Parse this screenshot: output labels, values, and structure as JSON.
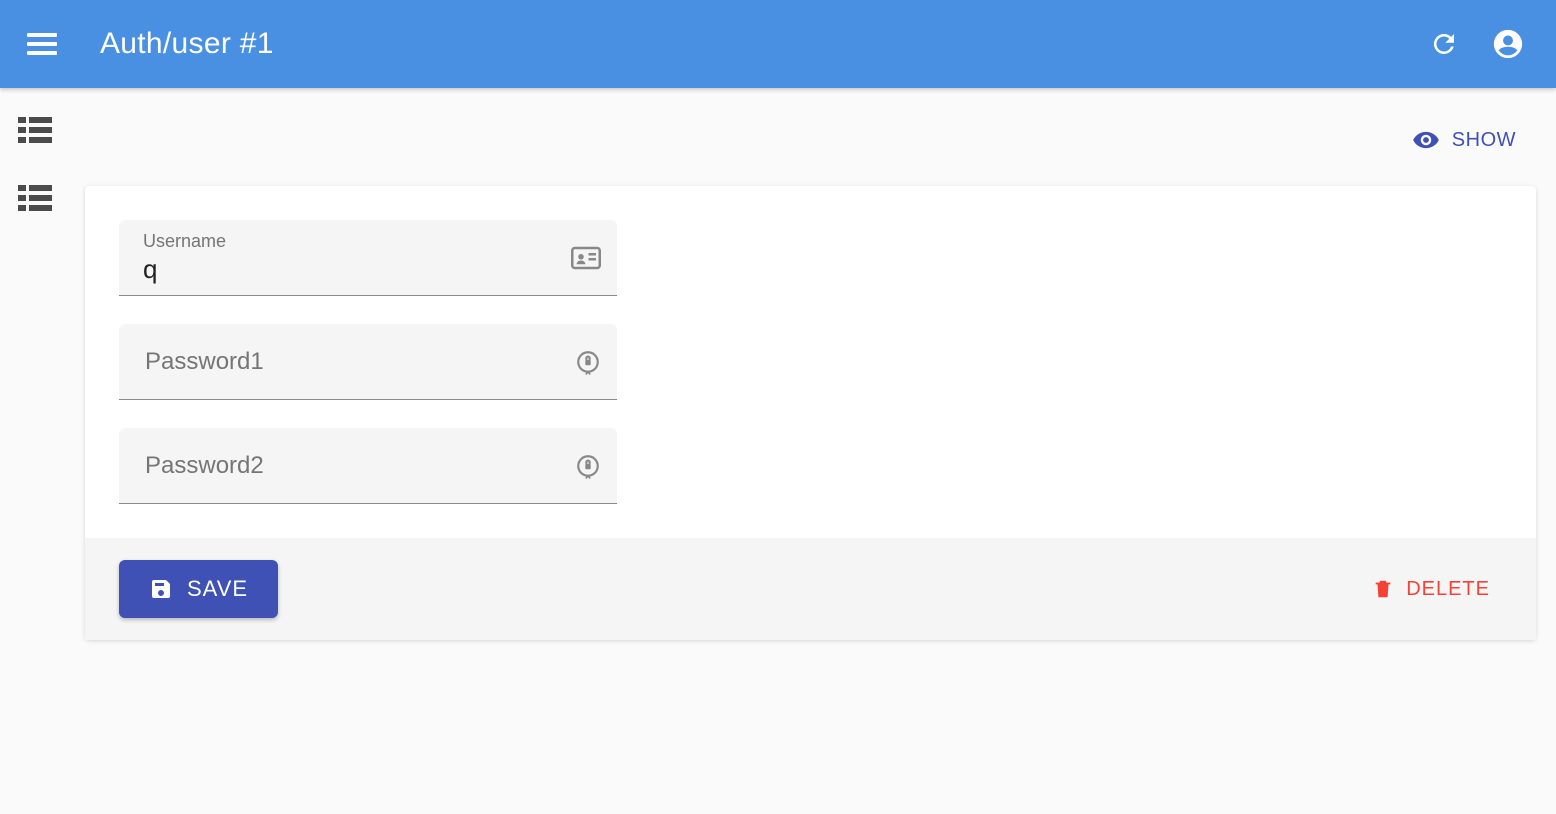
{
  "appbar": {
    "title": "Auth/user #1"
  },
  "sidebar": {
    "items": [
      {
        "name": "nav-item-1"
      },
      {
        "name": "nav-item-2"
      }
    ]
  },
  "topActions": {
    "show_label": "SHOW"
  },
  "form": {
    "username_label": "Username",
    "username_value": "q",
    "password1_placeholder": "Password1",
    "password1_value": "",
    "password2_placeholder": "Password2",
    "password2_value": ""
  },
  "actions": {
    "save_label": "SAVE",
    "delete_label": "DELETE"
  },
  "colors": {
    "primary": "#4a90e2",
    "indigo": "#3f51b5",
    "danger": "#f44336"
  }
}
